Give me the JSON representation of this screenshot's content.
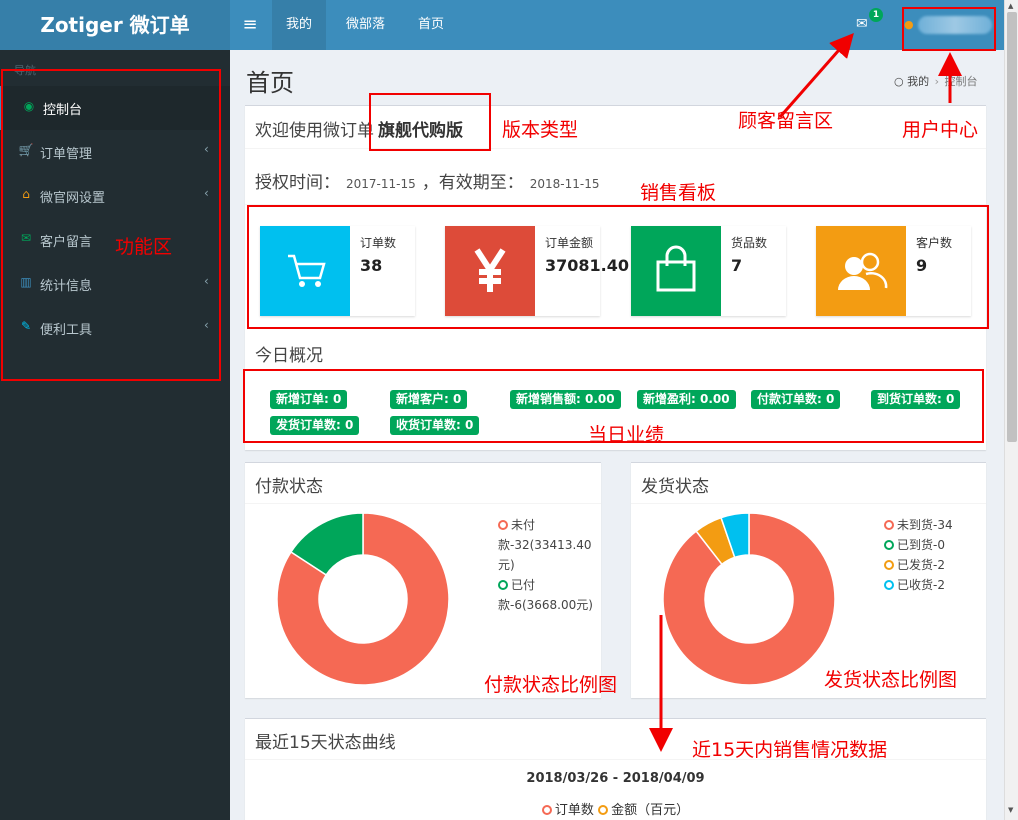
{
  "header": {
    "logo": "Zotiger 微订单",
    "menu_icon": "≡",
    "nav": [
      {
        "label": "我的",
        "active": true
      },
      {
        "label": "微部落",
        "active": false
      },
      {
        "label": "首页",
        "active": false
      }
    ],
    "mail_count": "1"
  },
  "sidebar": {
    "header": "导航",
    "items": [
      {
        "label": "控制台",
        "icon": "dashboard-icon",
        "glyph": "◉",
        "color": "#00a65a",
        "active": true,
        "chevron": false
      },
      {
        "label": "订单管理",
        "icon": "cart-icon",
        "glyph": "🛒",
        "color": "#dd4b39",
        "active": false,
        "chevron": true
      },
      {
        "label": "微官网设置",
        "icon": "home-icon",
        "glyph": "⌂",
        "color": "#f39c12",
        "active": false,
        "chevron": true
      },
      {
        "label": "客户留言",
        "icon": "envelope-icon",
        "glyph": "✉",
        "color": "#00a65a",
        "active": false,
        "chevron": false
      },
      {
        "label": "统计信息",
        "icon": "bar-chart-icon",
        "glyph": "▥",
        "color": "#3c8dbc",
        "active": false,
        "chevron": true
      },
      {
        "label": "便利工具",
        "icon": "wrench-icon",
        "glyph": "✎",
        "color": "#00c0ef",
        "active": false,
        "chevron": true
      }
    ]
  },
  "page": {
    "title": "首页",
    "breadcrumb": [
      "我的",
      "控制台"
    ]
  },
  "welcome": {
    "text": "欢迎使用微订单",
    "edition": "旗舰代购版",
    "auth_label": "授权时间：",
    "auth_date": "2017-11-15",
    "valid_label": "，有效期至：",
    "valid_date": "2018-11-15"
  },
  "stats": [
    {
      "label": "订单数",
      "value": "38",
      "icon": "cart-icon",
      "color": "#00c0ef"
    },
    {
      "label": "订单金额",
      "value": "37081.40",
      "icon": "yen-icon",
      "color": "#dd4b39"
    },
    {
      "label": "货品数",
      "value": "7",
      "icon": "shopping-bag-icon",
      "color": "#00a65a"
    },
    {
      "label": "客户数",
      "value": "9",
      "icon": "users-icon",
      "color": "#f39c12"
    }
  ],
  "today": {
    "title": "今日概况",
    "badges": [
      "新增订单: 0",
      "新增客户: 0",
      "新增销售额: 0.00",
      "新增盈利: 0.00",
      "付款订单数: 0",
      "到货订单数: 0",
      "发货订单数: 0",
      "收货订单数: 0"
    ]
  },
  "payment_chart": {
    "title": "付款状态",
    "type": "pie",
    "slices": [
      {
        "name": "未付款",
        "label": "未付款-32(33413.40元)",
        "value": 32,
        "color": "#f56954"
      },
      {
        "name": "已付款",
        "label": "已付款-6(3668.00元)",
        "value": 6,
        "color": "#00a65a"
      }
    ]
  },
  "shipping_chart": {
    "title": "发货状态",
    "type": "pie",
    "slices": [
      {
        "name": "未到货",
        "label": "未到货-34",
        "value": 34,
        "color": "#f56954"
      },
      {
        "name": "已到货",
        "label": "已到货-0",
        "value": 0,
        "color": "#00a65a"
      },
      {
        "name": "已发货",
        "label": "已发货-2",
        "value": 2,
        "color": "#f39c12"
      },
      {
        "name": "已收货",
        "label": "已收货-2",
        "value": 2,
        "color": "#00c0ef"
      }
    ]
  },
  "trend": {
    "box_title": "最近15天状态曲线",
    "chart_title": "2018/03/26 - 2018/04/09",
    "legend": [
      {
        "label": "订单数",
        "color": "#f56954"
      },
      {
        "label": "金额（百元）",
        "color": "#f39c12"
      }
    ]
  },
  "chart_data": [
    {
      "type": "pie",
      "title": "付款状态",
      "labels": [
        "未付款",
        "已付款"
      ],
      "values": [
        32,
        6
      ],
      "amounts": [
        33413.4,
        3668.0
      ],
      "colors": [
        "#f56954",
        "#00a65a"
      ],
      "legend": "right"
    },
    {
      "type": "pie",
      "title": "发货状态",
      "labels": [
        "未到货",
        "已到货",
        "已发货",
        "已收货"
      ],
      "values": [
        34,
        0,
        2,
        2
      ],
      "colors": [
        "#f56954",
        "#00a65a",
        "#f39c12",
        "#00c0ef"
      ],
      "legend": "right"
    }
  ],
  "annotations": {
    "edition": "版本类型",
    "messages": "顾客留言区",
    "user": "用户中心",
    "sales": "销售看板",
    "functions": "功能区",
    "today": "当日业绩",
    "pay_ratio": "付款状态比例图",
    "ship_ratio": "发货状态比例图",
    "recent": "近15天内销售情况数据",
    "color": "#f10000"
  }
}
